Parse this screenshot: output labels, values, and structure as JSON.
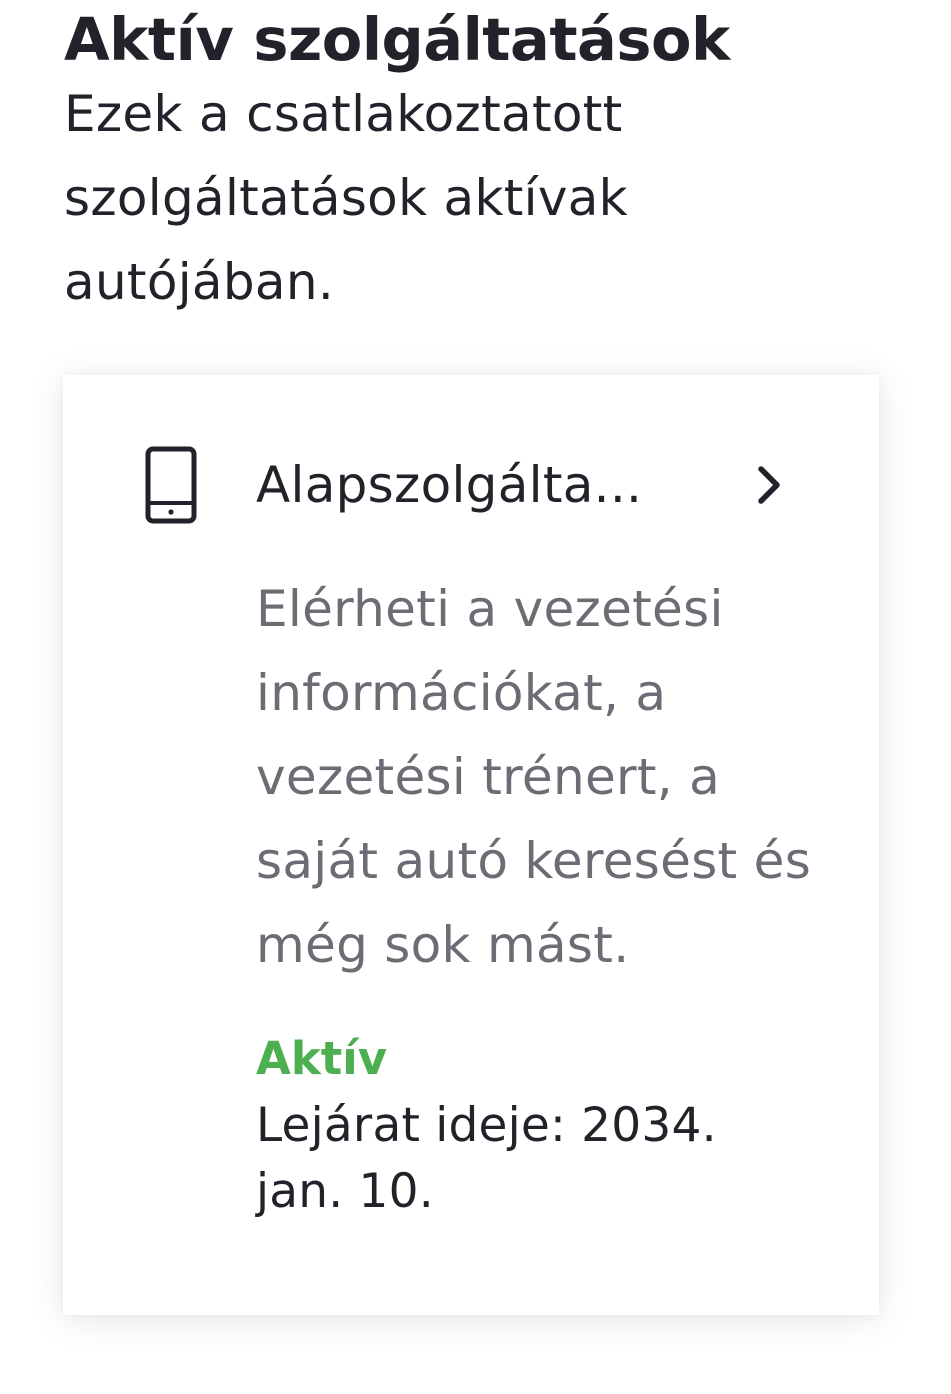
{
  "page": {
    "title": "Aktív szolgáltatások",
    "description": "Ezek a csatlakoztatott szolgáltatások aktívak autójában."
  },
  "service_card": {
    "icon": "smartphone-icon",
    "title": "Alapszolgálta...",
    "chevron_icon": "chevron-right-icon",
    "description": "Elérheti a vezetési információkat, a vezetési trénert, a saját autó keresést és még sok mást.",
    "status": "Aktív",
    "expiry": "Lejárat ideje: 2034. jan. 10."
  },
  "colors": {
    "text_primary": "#22222a",
    "text_secondary": "#6c6c75",
    "status_active": "#4caf50",
    "card_background": "#ffffff"
  }
}
